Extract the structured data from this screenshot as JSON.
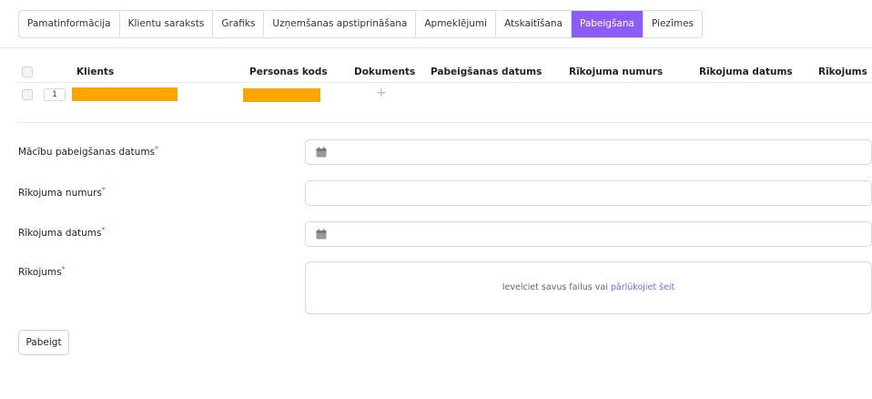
{
  "tabs": [
    {
      "label": "Pamatinformācija",
      "active": false
    },
    {
      "label": "Klientu saraksts",
      "active": false
    },
    {
      "label": "Grafiks",
      "active": false
    },
    {
      "label": "Uzņemšanas apstiprināšana",
      "active": false
    },
    {
      "label": "Apmeklējumi",
      "active": false
    },
    {
      "label": "Atskaitīšana",
      "active": false
    },
    {
      "label": "Pabeigšana",
      "active": true
    },
    {
      "label": "Piezīmes",
      "active": false
    }
  ],
  "table": {
    "headers": {
      "client": "Klients",
      "personal_code": "Personas kods",
      "documents": "Dokuments",
      "completion_date": "Pabeigšanas datums",
      "order_number": "Rīkojuma numurs",
      "order_date": "Rīkojuma datums",
      "order": "Rīkojums"
    },
    "rows": [
      {
        "number": "1",
        "client": "[redacted]",
        "personal_code": "[redacted]",
        "documents_icon": "plus-icon"
      }
    ]
  },
  "form": {
    "completion_date_label": "Mācību pabeigšanas datums",
    "order_number_label": "Rīkojuma numurs",
    "order_date_label": "Rīkojuma datums",
    "order_label": "Rīkojums",
    "required_mark": "*",
    "drop_text": "Ievelciet savus failus vai",
    "drop_link": "pārlūkojiet šeit"
  },
  "actions": {
    "finish_label": "Pabeigt"
  },
  "colors": {
    "accent": "#8b5cf6",
    "redaction": "#ffa500",
    "required": "#e53935"
  }
}
